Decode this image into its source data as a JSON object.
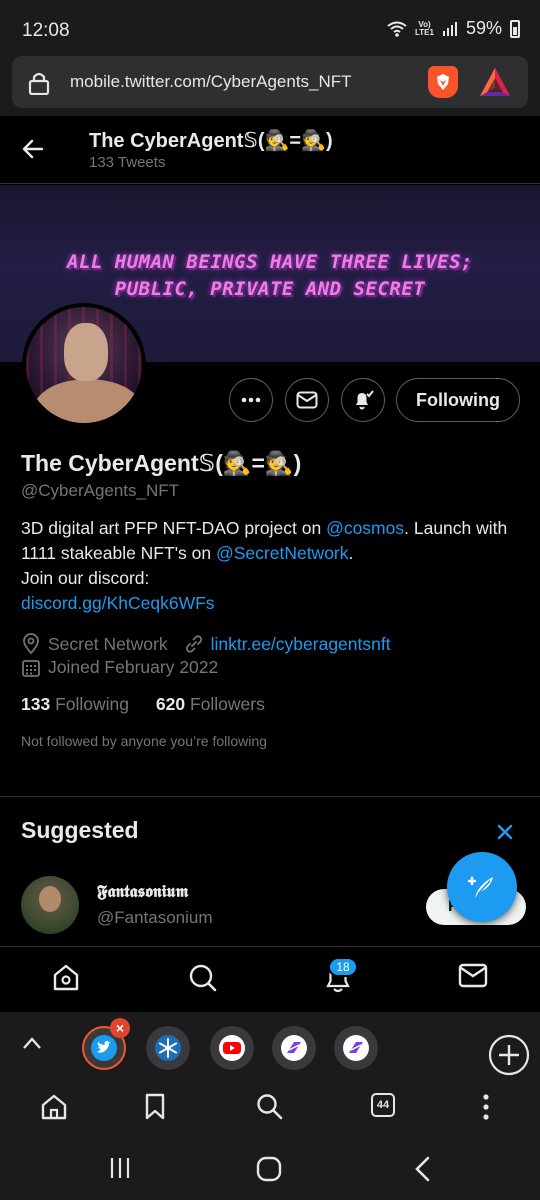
{
  "status_bar": {
    "time": "12:08",
    "network": "LTE1",
    "battery": "59%"
  },
  "browser": {
    "url": "mobile.twitter.com/CyberAgents_NFT",
    "tab_count": "44"
  },
  "header": {
    "name": "The CyberAgent𝕊(🕵️=🕵️)",
    "tweet_count": "133 Tweets"
  },
  "banner": {
    "line1": "ALL HUMAN BEINGS HAVE THREE LIVES;",
    "line2": "PUBLIC, PRIVATE AND SECRET"
  },
  "actions": {
    "follow_label": "Following"
  },
  "profile": {
    "name": "The CyberAgent𝕊(🕵️=🕵️)",
    "handle": "@CyberAgents_NFT",
    "bio": {
      "t1": "3D digital art PFP NFT-DAO project on ",
      "m1": "@cosmos",
      "t2": ". Launch with 1111 stakeable NFT's on ",
      "m2": "@SecretNetwork",
      "t3": ".",
      "t4": "Join our discord:",
      "link": "discord.gg/KhCeqk6WFs"
    },
    "location": "Secret Network",
    "website": "linktr.ee/cyberagentsnft",
    "joined": "Joined February 2022",
    "following_count": "133",
    "following_label": "Following",
    "followers_count": "620",
    "followers_label": "Followers",
    "not_followed": "Not followed by anyone you’re following"
  },
  "suggested": {
    "title": "Suggested",
    "user_name": "𝕱𝖆𝖓𝖙𝖆𝖘𝖔𝖓𝖎𝖚𝖒",
    "user_handle": "@Fantasonium",
    "follow_label": "F"
  },
  "nav": {
    "notifications_badge": "18"
  },
  "colors": {
    "accent": "#1d9bf0",
    "brave": "#fb542b",
    "background": "#000000"
  },
  "icons": [
    "lock-icon",
    "brave-icon",
    "rewards-icon",
    "back-arrow-icon",
    "more-icon",
    "mail-icon",
    "bell-icon",
    "location-icon",
    "link-icon",
    "calendar-icon",
    "close-icon",
    "compose-icon",
    "home-icon",
    "search-icon",
    "twitter-icon",
    "snowflake-icon",
    "youtube-icon",
    "chevron-up-icon",
    "plus-icon",
    "bookmark-icon",
    "kebab-icon",
    "recents-icon",
    "android-home-icon",
    "android-back-icon"
  ]
}
